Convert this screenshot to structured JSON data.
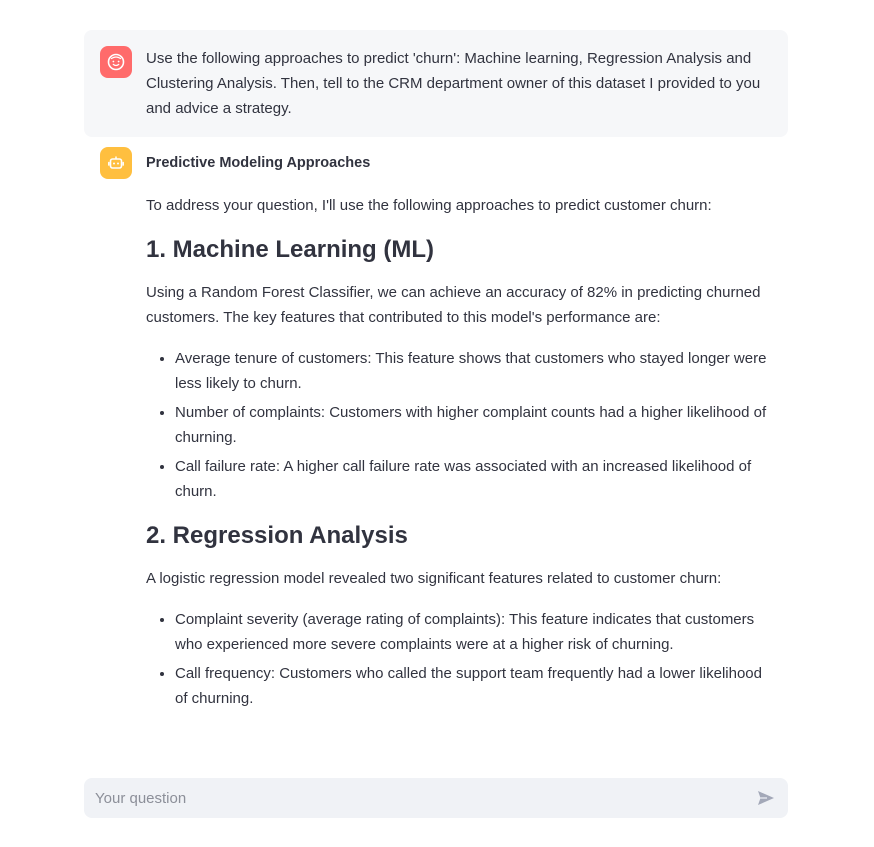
{
  "user_message": {
    "text": "Use the following approaches to predict 'churn': Machine learning, Regression Analysis and Clustering Analysis. Then, tell to the CRM department owner of this dataset I provided to you and advice a strategy."
  },
  "assistant_message": {
    "title": "Predictive Modeling Approaches",
    "intro": "To address your question, I'll use the following approaches to predict customer churn:",
    "sections": [
      {
        "heading": "1. Machine Learning (ML)",
        "paragraph": "Using a Random Forest Classifier, we can achieve an accuracy of 82% in predicting churned customers. The key features that contributed to this model's performance are:",
        "bullets": [
          "Average tenure of customers: This feature shows that customers who stayed longer were less likely to churn.",
          "Number of complaints: Customers with higher complaint counts had a higher likelihood of churning.",
          "Call failure rate: A higher call failure rate was associated with an increased likelihood of churn."
        ]
      },
      {
        "heading": "2. Regression Analysis",
        "paragraph": "A logistic regression model revealed two significant features related to customer churn:",
        "bullets": [
          "Complaint severity (average rating of complaints): This feature indicates that customers who experienced more severe complaints were at a higher risk of churning.",
          "Call frequency: Customers who called the support team frequently had a lower likelihood of churning."
        ]
      }
    ]
  },
  "chat_input": {
    "placeholder": "Your question"
  },
  "colors": {
    "user_avatar": "#ff6b6b",
    "bot_avatar": "#ffbf3f",
    "user_bubble": "#f6f7f9",
    "input_bg": "#f0f2f6",
    "text": "#31333f"
  }
}
